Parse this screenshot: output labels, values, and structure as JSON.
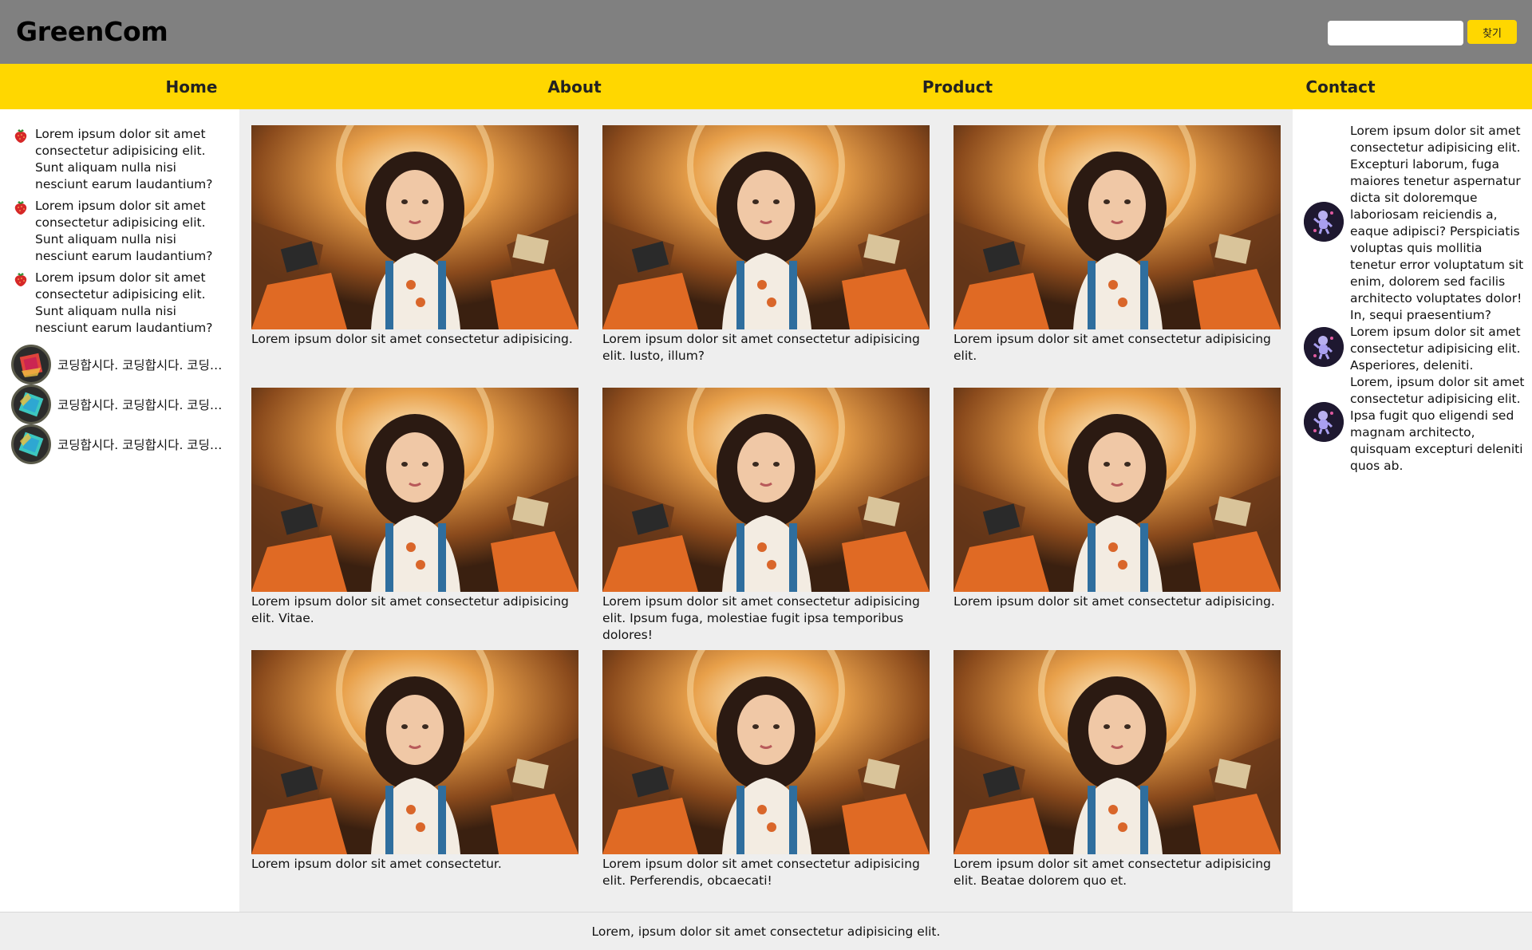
{
  "header": {
    "logo": "GreenCom",
    "search": {
      "placeholder": "",
      "value": "",
      "button_label": "찾기"
    }
  },
  "nav": {
    "items": [
      {
        "label": "Home"
      },
      {
        "label": "About"
      },
      {
        "label": "Product"
      },
      {
        "label": "Contact"
      }
    ]
  },
  "left_aside": {
    "list_items": [
      {
        "icon": "strawberry-icon",
        "text": "Lorem ipsum dolor sit amet consectetur adipisicing elit. Sunt aliquam nulla nisi nesciunt earum laudantium?"
      },
      {
        "icon": "strawberry-icon",
        "text": "Lorem ipsum dolor sit amet consectetur adipisicing elit. Sunt aliquam nulla nisi nesciunt earum laudantium?"
      },
      {
        "icon": "strawberry-icon",
        "text": "Lorem ipsum dolor sit amet consectetur adipisicing elit. Sunt aliquam nulla nisi nesciunt earum laudantium?"
      }
    ],
    "avatar_rows": [
      {
        "icon": "cube-icon",
        "text": "코딩합시다. 코딩합시다. 코딩합시다."
      },
      {
        "icon": "cube-icon",
        "text": "코딩합시다. 코딩합시다. 코딩합시다."
      },
      {
        "icon": "cube-icon",
        "text": "코딩합시다. 코딩합시다. 코딩합시다."
      }
    ]
  },
  "main": {
    "cards": [
      {
        "caption": "Lorem ipsum dolor sit amet consectetur adipisicing."
      },
      {
        "caption": "Lorem ipsum dolor sit amet consectetur adipisicing elit. Iusto, illum?"
      },
      {
        "caption": "Lorem ipsum dolor sit amet consectetur adipisicing elit."
      },
      {
        "caption": "Lorem ipsum dolor sit amet consectetur adipisicing elit. Vitae."
      },
      {
        "caption": "Lorem ipsum dolor sit amet consectetur adipisicing elit. Ipsum fuga, molestiae fugit ipsa temporibus dolores!"
      },
      {
        "caption": "Lorem ipsum dolor sit amet consectetur adipisicing."
      },
      {
        "caption": "Lorem ipsum dolor sit amet consectetur."
      },
      {
        "caption": "Lorem ipsum dolor sit amet consectetur adipisicing elit. Perferendis, obcaecati!"
      },
      {
        "caption": "Lorem ipsum dolor sit amet consectetur adipisicing elit. Beatae dolorem quo et."
      }
    ]
  },
  "right_aside": {
    "avatars": [
      {
        "icon": "astronaut-icon"
      },
      {
        "icon": "astronaut-icon"
      },
      {
        "icon": "astronaut-icon"
      }
    ],
    "paragraphs": [
      "Lorem ipsum dolor sit amet consectetur adipisicing elit. Excepturi laborum, fuga maiores tenetur aspernatur dicta sit doloremque laboriosam reiciendis a, eaque adipisci? Perspiciatis voluptas quis mollitia tenetur error voluptatum sit enim, dolorem sed facilis architecto voluptates dolor! In, sequi praesentium?",
      "Lorem ipsum dolor sit amet consectetur adipisicing elit. Asperiores, deleniti.",
      "Lorem, ipsum dolor sit amet consectetur adipisicing elit. Ipsa fugit quo eligendi sed magnam architecto, quisquam excepturi deleniti quos ab."
    ]
  },
  "footer": {
    "text": "Lorem, ipsum dolor sit amet consectetur adipisicing elit."
  },
  "colors": {
    "header_bg": "#808080",
    "nav_bg": "#FFD700",
    "main_bg": "#EEEEEE",
    "search_button_bg": "#FFD700"
  }
}
